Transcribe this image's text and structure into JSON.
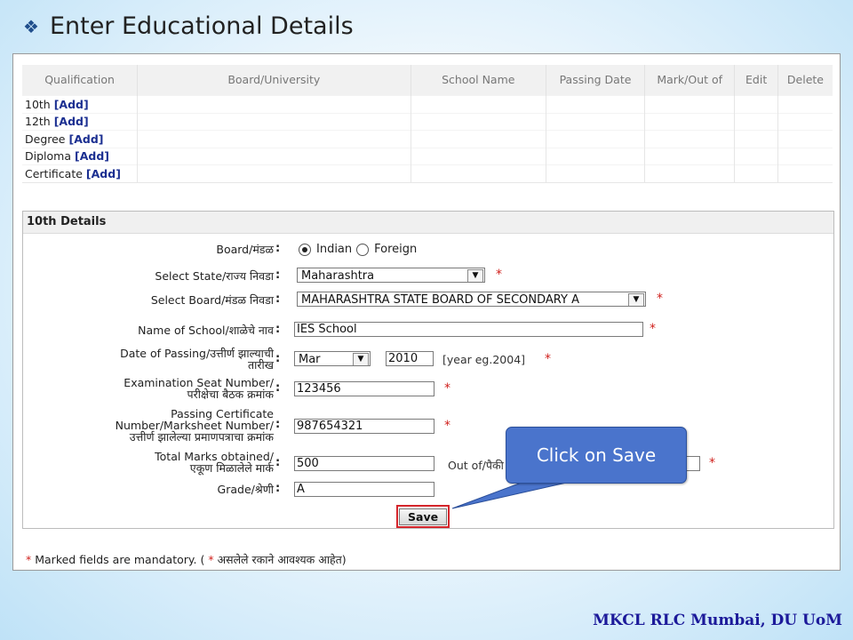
{
  "slide": {
    "title": "Enter Educational Details",
    "footer": "MKCL RLC Mumbai, DU UoM"
  },
  "qualification_table": {
    "headers": [
      "Qualification",
      "Board/University",
      "School Name",
      "Passing Date",
      "Mark/Out of",
      "Edit",
      "Delete"
    ],
    "rows": [
      {
        "label": "10th",
        "link": "[Add]"
      },
      {
        "label": "12th",
        "link": "[Add]"
      },
      {
        "label": "Degree",
        "link": "[Add]"
      },
      {
        "label": "Diploma",
        "link": "[Add]"
      },
      {
        "label": "Certificate",
        "link": "[Add]"
      }
    ]
  },
  "details": {
    "heading": "10th Details",
    "colon": ":",
    "star": "*",
    "board": {
      "label": "Board/मंडळ",
      "options": [
        "Indian",
        "Foreign"
      ],
      "selected": "Indian"
    },
    "state": {
      "label": "Select State/राज्य निवडा",
      "value": "Maharashtra"
    },
    "board_select": {
      "label": "Select Board/मंडळ निवडा",
      "value": "MAHARASHTRA STATE BOARD OF SECONDARY A"
    },
    "school": {
      "label": "Name of School/शाळेचे नाव",
      "value": "IES School"
    },
    "passing": {
      "label_line1": "Date of Passing/उत्तीर्ण झाल्याची",
      "label_line2": "तारीख",
      "month": "Mar",
      "year": "2010",
      "hint": "[year eg.2004]"
    },
    "seat": {
      "label_line1": "Examination Seat Number/",
      "label_line2": "परीक्षेचा बैठक क्रमांक",
      "value": "123456"
    },
    "certificate": {
      "label_line1": "Passing Certificate",
      "label_line2": "Number/Marksheet Number/",
      "label_line3": "उत्तीर्ण झालेल्या प्रमाणपत्राचा क्रमांक",
      "value": "987654321"
    },
    "marks": {
      "label_line1": "Total Marks obtained/",
      "label_line2": "एकूण मिळालेले मार्क",
      "value": "500",
      "out_of_label": "Out of/पैकी"
    },
    "grade": {
      "label": "Grade/श्रेणी",
      "value": "A"
    },
    "save_label": "Save"
  },
  "mandatory_note": {
    "part1": "Marked fields are mandatory. (",
    "part2": "असलेले रकाने आवश्यक आहेत)"
  },
  "callout": {
    "text": "Click on Save"
  },
  "colors": {
    "accent_blue": "#4a74cc",
    "highlight_red": "#d5262c",
    "required_red": "#d0201c",
    "footer_blue": "#1c1a9a"
  }
}
